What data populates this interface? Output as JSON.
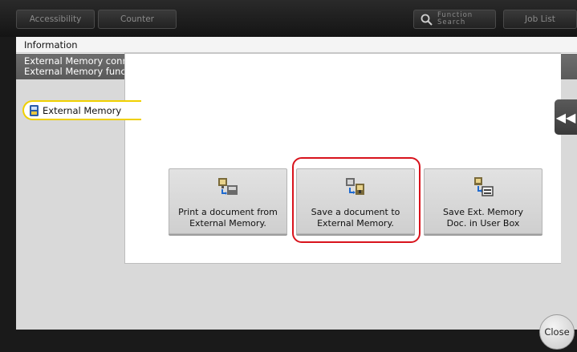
{
  "topbar": {
    "accessibility_label": "Accessibility",
    "counter_label": "Counter",
    "function_search_label": "Function\nSearch",
    "job_list_label": "Job List"
  },
  "dialog": {
    "title": "Information",
    "message_line1": "External Memory connected. Select the",
    "message_line2": "External Memory function you wish to perform.",
    "tab_label": "External Memory"
  },
  "functions": [
    {
      "label": "Print a document from\nExternal Memory.",
      "icon": "print-from-memory-icon"
    },
    {
      "label": "Save a document to\nExternal Memory.",
      "icon": "save-to-memory-icon"
    },
    {
      "label": "Save Ext. Memory\nDoc. in User Box",
      "icon": "save-to-userbox-icon"
    }
  ],
  "highlight_color": "#d8131c",
  "close_label": "Close"
}
